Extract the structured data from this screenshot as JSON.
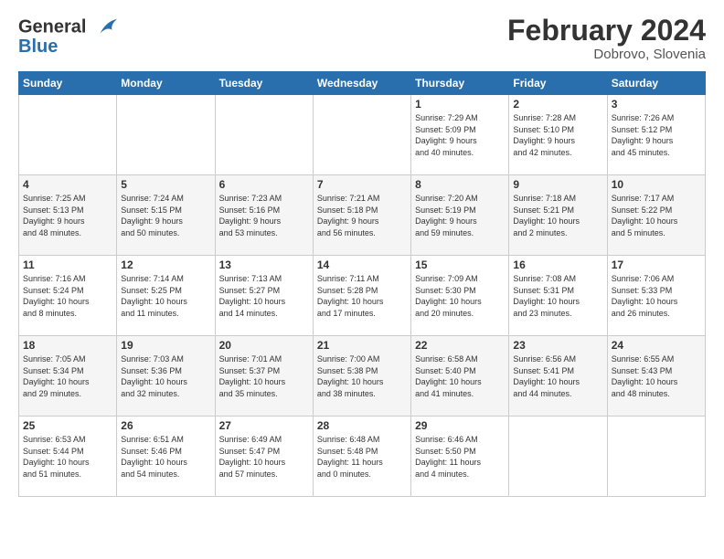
{
  "logo": {
    "line1": "General",
    "line2": "Blue"
  },
  "title": "February 2024",
  "location": "Dobrovo, Slovenia",
  "header_days": [
    "Sunday",
    "Monday",
    "Tuesday",
    "Wednesday",
    "Thursday",
    "Friday",
    "Saturday"
  ],
  "weeks": [
    [
      {
        "day": "",
        "info": ""
      },
      {
        "day": "",
        "info": ""
      },
      {
        "day": "",
        "info": ""
      },
      {
        "day": "",
        "info": ""
      },
      {
        "day": "1",
        "info": "Sunrise: 7:29 AM\nSunset: 5:09 PM\nDaylight: 9 hours\nand 40 minutes."
      },
      {
        "day": "2",
        "info": "Sunrise: 7:28 AM\nSunset: 5:10 PM\nDaylight: 9 hours\nand 42 minutes."
      },
      {
        "day": "3",
        "info": "Sunrise: 7:26 AM\nSunset: 5:12 PM\nDaylight: 9 hours\nand 45 minutes."
      }
    ],
    [
      {
        "day": "4",
        "info": "Sunrise: 7:25 AM\nSunset: 5:13 PM\nDaylight: 9 hours\nand 48 minutes."
      },
      {
        "day": "5",
        "info": "Sunrise: 7:24 AM\nSunset: 5:15 PM\nDaylight: 9 hours\nand 50 minutes."
      },
      {
        "day": "6",
        "info": "Sunrise: 7:23 AM\nSunset: 5:16 PM\nDaylight: 9 hours\nand 53 minutes."
      },
      {
        "day": "7",
        "info": "Sunrise: 7:21 AM\nSunset: 5:18 PM\nDaylight: 9 hours\nand 56 minutes."
      },
      {
        "day": "8",
        "info": "Sunrise: 7:20 AM\nSunset: 5:19 PM\nDaylight: 9 hours\nand 59 minutes."
      },
      {
        "day": "9",
        "info": "Sunrise: 7:18 AM\nSunset: 5:21 PM\nDaylight: 10 hours\nand 2 minutes."
      },
      {
        "day": "10",
        "info": "Sunrise: 7:17 AM\nSunset: 5:22 PM\nDaylight: 10 hours\nand 5 minutes."
      }
    ],
    [
      {
        "day": "11",
        "info": "Sunrise: 7:16 AM\nSunset: 5:24 PM\nDaylight: 10 hours\nand 8 minutes."
      },
      {
        "day": "12",
        "info": "Sunrise: 7:14 AM\nSunset: 5:25 PM\nDaylight: 10 hours\nand 11 minutes."
      },
      {
        "day": "13",
        "info": "Sunrise: 7:13 AM\nSunset: 5:27 PM\nDaylight: 10 hours\nand 14 minutes."
      },
      {
        "day": "14",
        "info": "Sunrise: 7:11 AM\nSunset: 5:28 PM\nDaylight: 10 hours\nand 17 minutes."
      },
      {
        "day": "15",
        "info": "Sunrise: 7:09 AM\nSunset: 5:30 PM\nDaylight: 10 hours\nand 20 minutes."
      },
      {
        "day": "16",
        "info": "Sunrise: 7:08 AM\nSunset: 5:31 PM\nDaylight: 10 hours\nand 23 minutes."
      },
      {
        "day": "17",
        "info": "Sunrise: 7:06 AM\nSunset: 5:33 PM\nDaylight: 10 hours\nand 26 minutes."
      }
    ],
    [
      {
        "day": "18",
        "info": "Sunrise: 7:05 AM\nSunset: 5:34 PM\nDaylight: 10 hours\nand 29 minutes."
      },
      {
        "day": "19",
        "info": "Sunrise: 7:03 AM\nSunset: 5:36 PM\nDaylight: 10 hours\nand 32 minutes."
      },
      {
        "day": "20",
        "info": "Sunrise: 7:01 AM\nSunset: 5:37 PM\nDaylight: 10 hours\nand 35 minutes."
      },
      {
        "day": "21",
        "info": "Sunrise: 7:00 AM\nSunset: 5:38 PM\nDaylight: 10 hours\nand 38 minutes."
      },
      {
        "day": "22",
        "info": "Sunrise: 6:58 AM\nSunset: 5:40 PM\nDaylight: 10 hours\nand 41 minutes."
      },
      {
        "day": "23",
        "info": "Sunrise: 6:56 AM\nSunset: 5:41 PM\nDaylight: 10 hours\nand 44 minutes."
      },
      {
        "day": "24",
        "info": "Sunrise: 6:55 AM\nSunset: 5:43 PM\nDaylight: 10 hours\nand 48 minutes."
      }
    ],
    [
      {
        "day": "25",
        "info": "Sunrise: 6:53 AM\nSunset: 5:44 PM\nDaylight: 10 hours\nand 51 minutes."
      },
      {
        "day": "26",
        "info": "Sunrise: 6:51 AM\nSunset: 5:46 PM\nDaylight: 10 hours\nand 54 minutes."
      },
      {
        "day": "27",
        "info": "Sunrise: 6:49 AM\nSunset: 5:47 PM\nDaylight: 10 hours\nand 57 minutes."
      },
      {
        "day": "28",
        "info": "Sunrise: 6:48 AM\nSunset: 5:48 PM\nDaylight: 11 hours\nand 0 minutes."
      },
      {
        "day": "29",
        "info": "Sunrise: 6:46 AM\nSunset: 5:50 PM\nDaylight: 11 hours\nand 4 minutes."
      },
      {
        "day": "",
        "info": ""
      },
      {
        "day": "",
        "info": ""
      }
    ]
  ]
}
